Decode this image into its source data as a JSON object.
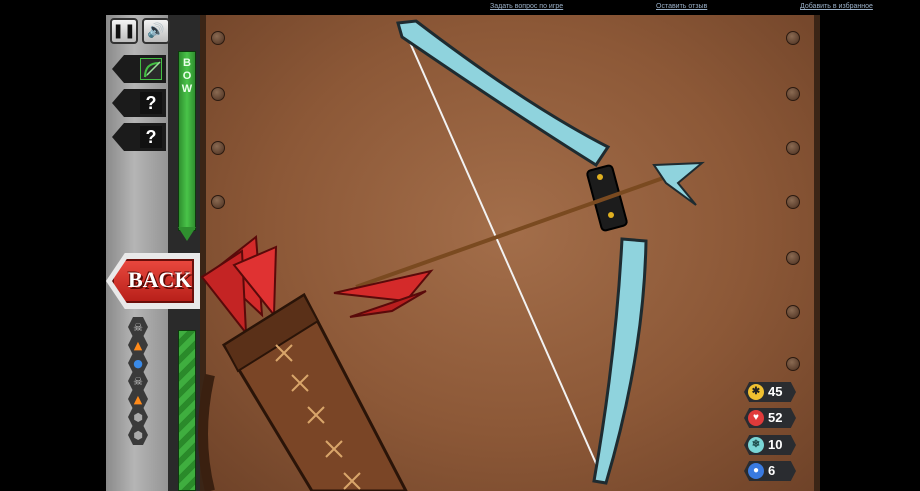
{
  "top_links": {
    "ask": "Задать вопрос по игре",
    "review": "Оставить отзыв",
    "favorite": "Добавить в избранное"
  },
  "hud": {
    "pause_icon": "pause-icon",
    "sound_icon": "speaker-icon",
    "category_label": "BOW",
    "back_label": "BACK",
    "slots": [
      {
        "icon": "bow-icon",
        "content": ""
      },
      {
        "icon": "unknown-icon",
        "content": "?"
      },
      {
        "icon": "unknown-icon",
        "content": "?"
      }
    ],
    "element_icons": [
      "skull-icon",
      "fire-icon",
      "water-icon",
      "skull-icon",
      "fire-icon",
      "hexagon-icon",
      "hexagon-icon"
    ]
  },
  "stats": [
    {
      "name": "damage",
      "icon": "star-burst-icon",
      "value": "45",
      "color": "#f0c030"
    },
    {
      "name": "health",
      "icon": "heart-icon",
      "value": "52",
      "color": "#e03a3a"
    },
    {
      "name": "ice",
      "icon": "snowflake-icon",
      "value": "10",
      "color": "#7ad6d6"
    },
    {
      "name": "water",
      "icon": "drop-icon",
      "value": "6",
      "color": "#3a7ae0"
    }
  ],
  "colors": {
    "bow": "#8fd3dd",
    "arrow_fletch": "#d42a2a",
    "quiver": "#7a4526",
    "field": "#8c5837",
    "hud_green": "#49c349"
  }
}
